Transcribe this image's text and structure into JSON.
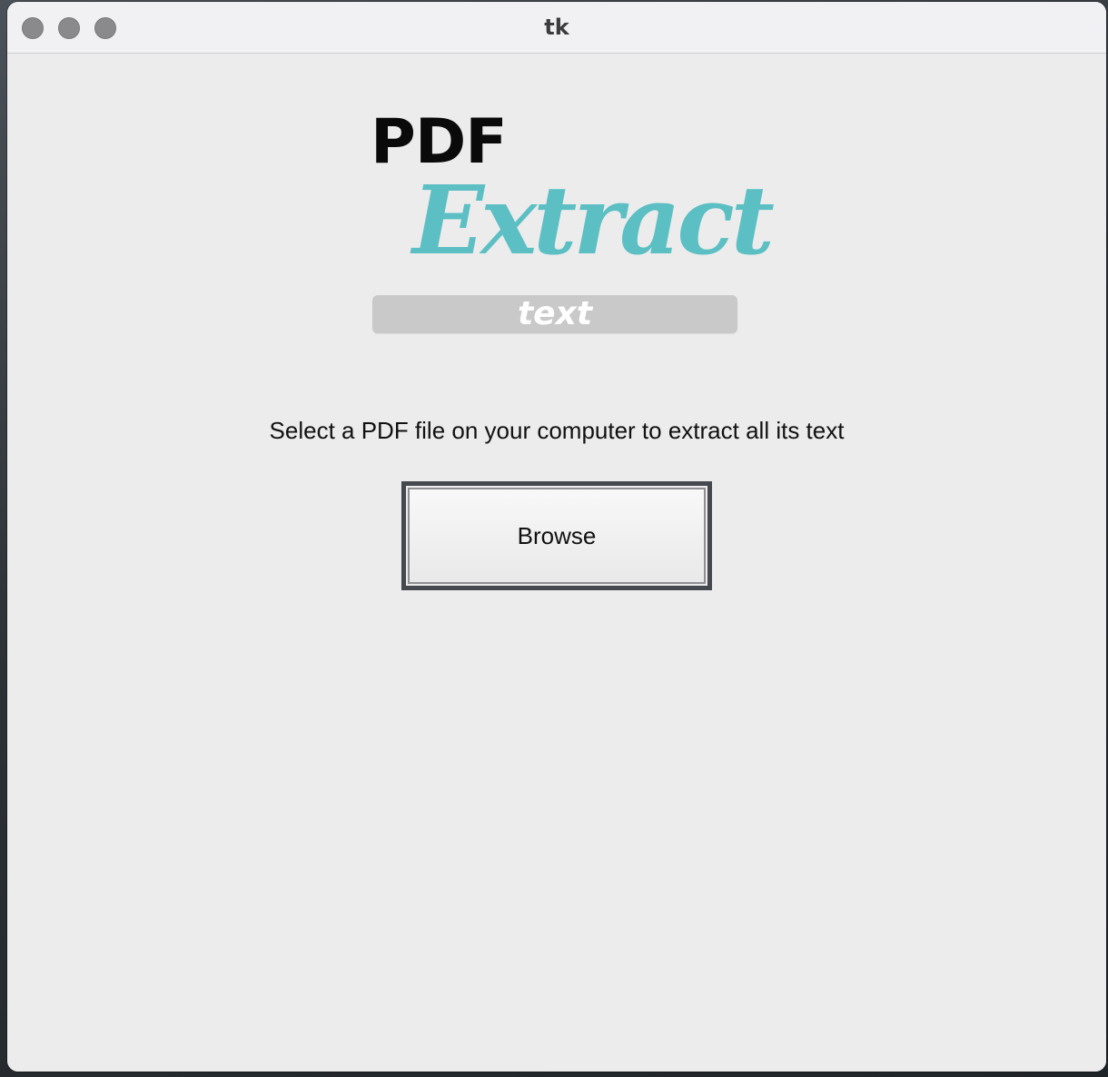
{
  "window": {
    "title": "tk"
  },
  "logo": {
    "line1": "PDF",
    "line2": "Extract",
    "line3": "text",
    "accent_color": "#5bbfc4",
    "bar_color": "#c9c9c9"
  },
  "main": {
    "instruction": "Select a PDF file on your computer to extract all its text",
    "browse_label": "Browse"
  }
}
